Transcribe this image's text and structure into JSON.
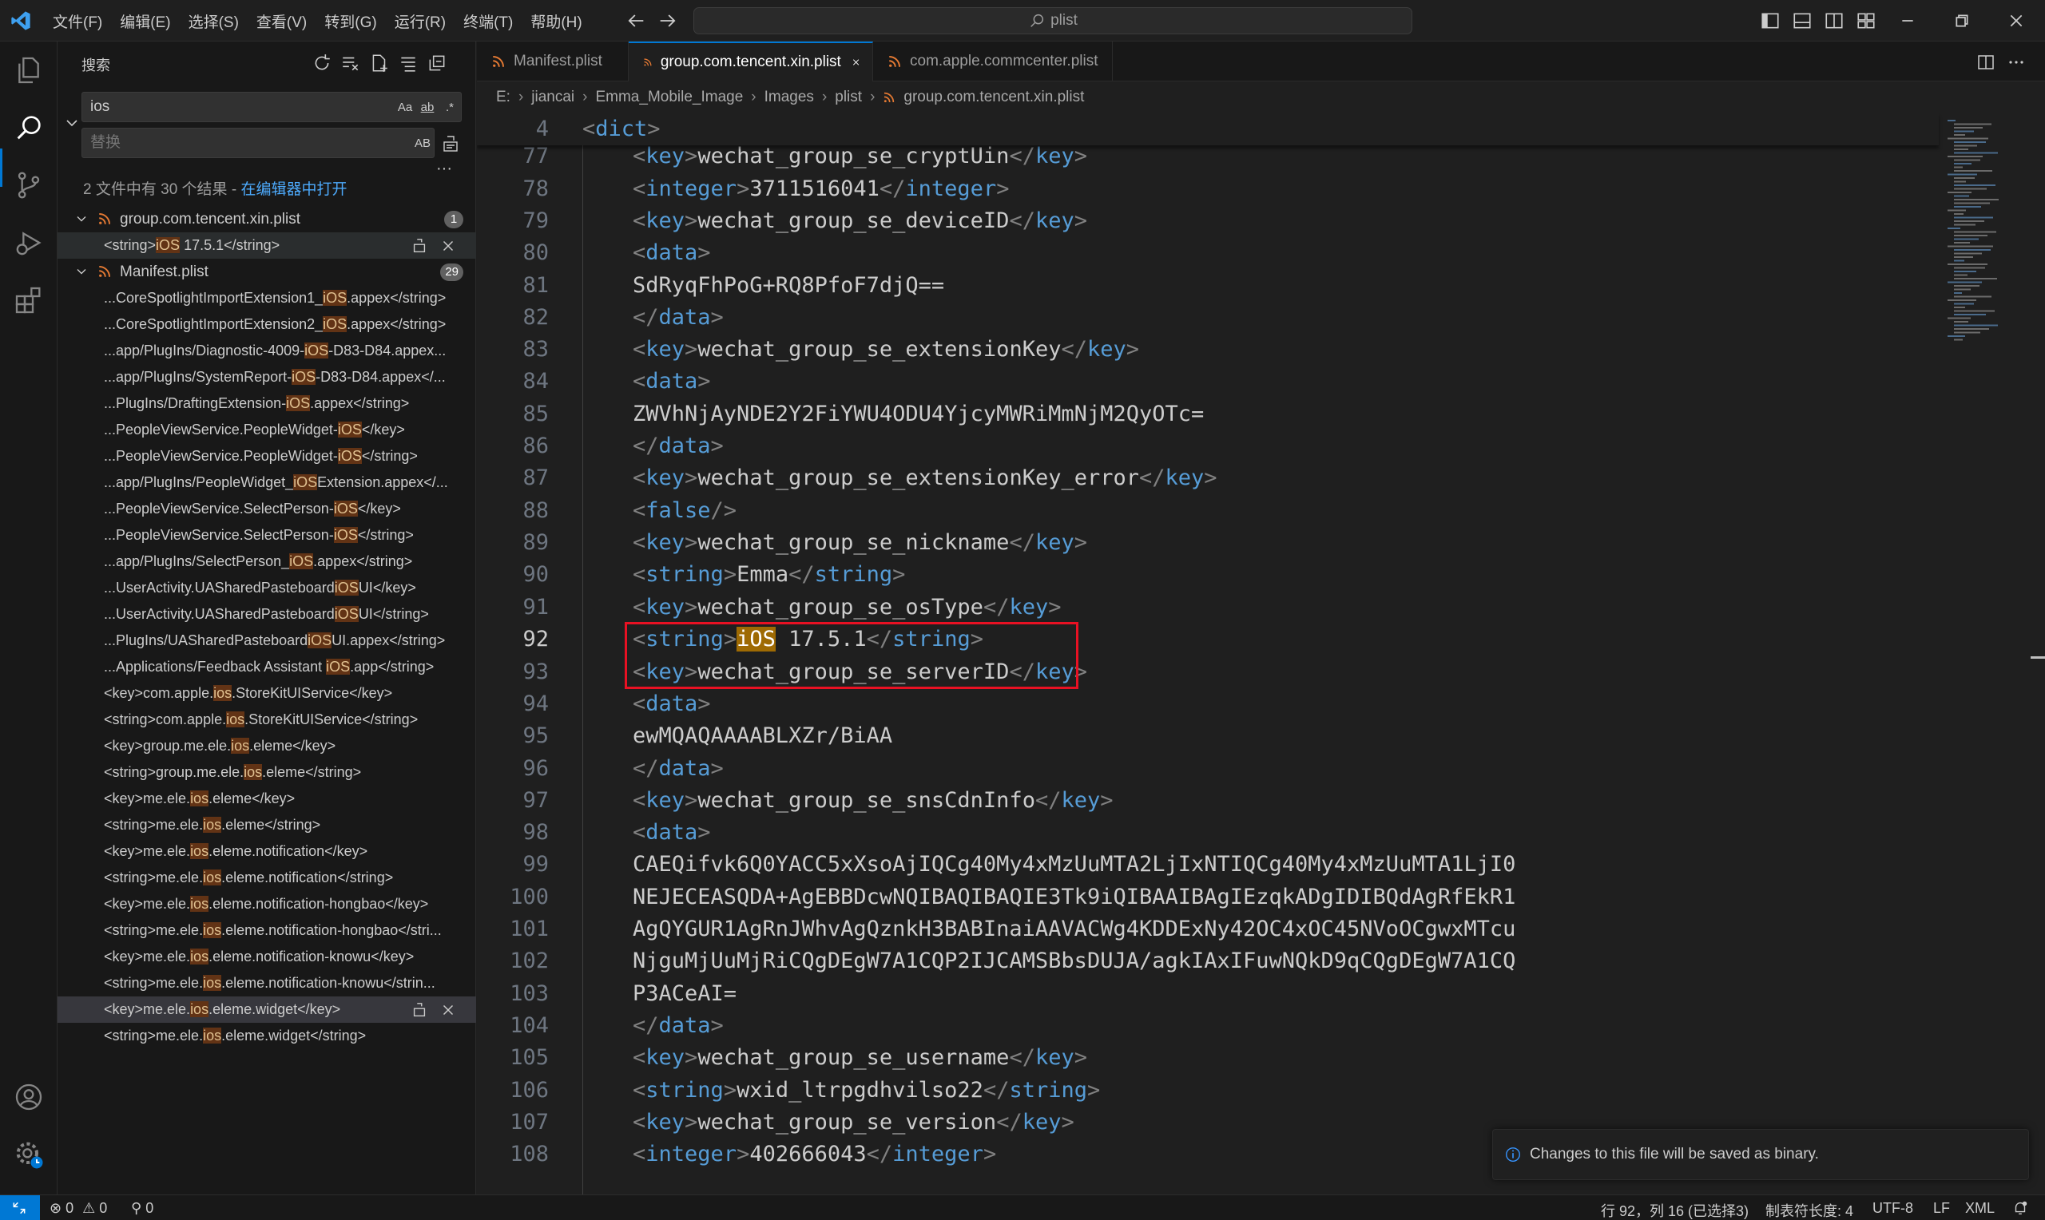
{
  "menu": [
    "文件(F)",
    "编辑(E)",
    "选择(S)",
    "查看(V)",
    "转到(G)",
    "运行(R)",
    "终端(T)",
    "帮助(H)"
  ],
  "command_center": {
    "text": "plist"
  },
  "sidebar": {
    "title": "搜索",
    "search_value": "ios",
    "search_options": [
      "Aa",
      "ab",
      ".*"
    ],
    "replace_placeholder": "替换",
    "replace_option": "AB",
    "summary": "2 文件中有 30 个结果 - ",
    "summary_link": "在编辑器中打开",
    "more": "···",
    "files": [
      {
        "name": "group.com.tencent.xin.plist",
        "count": "1",
        "matches": [
          {
            "pre": "<string>",
            "hit": "iOS",
            "post": " 17.5.1</string>",
            "state": "selected"
          }
        ]
      },
      {
        "name": "Manifest.plist",
        "count": "29",
        "matches": [
          {
            "pre": "...CoreSpotlightImportExtension1_",
            "hit": "iOS",
            "post": ".appex</string>"
          },
          {
            "pre": "...CoreSpotlightImportExtension2_",
            "hit": "iOS",
            "post": ".appex</string>"
          },
          {
            "pre": "...app/PlugIns/Diagnostic-4009-",
            "hit": "iOS",
            "post": "-D83-D84.appex..."
          },
          {
            "pre": "...app/PlugIns/SystemReport-",
            "hit": "iOS",
            "post": "-D83-D84.appex</..."
          },
          {
            "pre": "...PlugIns/DraftingExtension-",
            "hit": "iOS",
            "post": ".appex</string>"
          },
          {
            "pre": "...PeopleViewService.PeopleWidget-",
            "hit": "iOS",
            "post": "</key>"
          },
          {
            "pre": "...PeopleViewService.PeopleWidget-",
            "hit": "iOS",
            "post": "</string>"
          },
          {
            "pre": "...app/PlugIns/PeopleWidget_",
            "hit": "iOS",
            "post": "Extension.appex</..."
          },
          {
            "pre": "...PeopleViewService.SelectPerson-",
            "hit": "iOS",
            "post": "</key>"
          },
          {
            "pre": "...PeopleViewService.SelectPerson-",
            "hit": "iOS",
            "post": "</string>"
          },
          {
            "pre": "...app/PlugIns/SelectPerson_",
            "hit": "iOS",
            "post": ".appex</string>"
          },
          {
            "pre": "...UserActivity.UASharedPasteboard",
            "hit": "iOS",
            "post": "UI</key>"
          },
          {
            "pre": "...UserActivity.UASharedPasteboard",
            "hit": "iOS",
            "post": "UI</string>"
          },
          {
            "pre": "...PlugIns/UASharedPasteboard",
            "hit": "iOS",
            "post": "UI.appex</string>"
          },
          {
            "pre": "...Applications/Feedback Assistant ",
            "hit": "iOS",
            "post": ".app</string>"
          },
          {
            "pre": "<key>com.apple.",
            "hit": "ios",
            "post": ".StoreKitUIService</key>"
          },
          {
            "pre": "<string>com.apple.",
            "hit": "ios",
            "post": ".StoreKitUIService</string>"
          },
          {
            "pre": "<key>group.me.ele.",
            "hit": "ios",
            "post": ".eleme</key>"
          },
          {
            "pre": "<string>group.me.ele.",
            "hit": "ios",
            "post": ".eleme</string>"
          },
          {
            "pre": "<key>me.ele.",
            "hit": "ios",
            "post": ".eleme</key>"
          },
          {
            "pre": "<string>me.ele.",
            "hit": "ios",
            "post": ".eleme</string>"
          },
          {
            "pre": "<key>me.ele.",
            "hit": "ios",
            "post": ".eleme.notification</key>"
          },
          {
            "pre": "<string>me.ele.",
            "hit": "ios",
            "post": ".eleme.notification</string>"
          },
          {
            "pre": "<key>me.ele.",
            "hit": "ios",
            "post": ".eleme.notification-hongbao</key>"
          },
          {
            "pre": "<string>me.ele.",
            "hit": "ios",
            "post": ".eleme.notification-hongbao</stri..."
          },
          {
            "pre": "<key>me.ele.",
            "hit": "ios",
            "post": ".eleme.notification-knowu</key>"
          },
          {
            "pre": "<string>me.ele.",
            "hit": "ios",
            "post": ".eleme.notification-knowu</strin..."
          },
          {
            "pre": "<key>me.ele.",
            "hit": "ios",
            "post": ".eleme.widget</key>",
            "state": "active"
          },
          {
            "pre": "<string>me.ele.",
            "hit": "ios",
            "post": ".eleme.widget</string>"
          }
        ]
      }
    ]
  },
  "tabs": [
    {
      "label": "Manifest.plist",
      "active": false
    },
    {
      "label": "group.com.tencent.xin.plist",
      "active": true
    },
    {
      "label": "com.apple.commcenter.plist",
      "active": false
    }
  ],
  "breadcrumb": [
    "E:",
    "jiancai",
    "Emma_Mobile_Image",
    "Images",
    "plist",
    "group.com.tencent.xin.plist"
  ],
  "editor": {
    "sticky": {
      "ln": "4",
      "tag": "dict"
    },
    "current_line": "92",
    "highlight_word": "iOS",
    "lines": [
      {
        "ln": "76",
        "k": "close",
        "tag": "data"
      },
      {
        "ln": "77",
        "k": "el",
        "tag": "key",
        "text": "wechat_group_se_cryptUin"
      },
      {
        "ln": "78",
        "k": "el",
        "tag": "integer",
        "text": "3711516041"
      },
      {
        "ln": "79",
        "k": "el",
        "tag": "key",
        "text": "wechat_group_se_deviceID"
      },
      {
        "ln": "80",
        "k": "open",
        "tag": "data"
      },
      {
        "ln": "81",
        "k": "text",
        "text": "SdRyqFhPoG+RQ8PfoF7djQ=="
      },
      {
        "ln": "82",
        "k": "close",
        "tag": "data"
      },
      {
        "ln": "83",
        "k": "el",
        "tag": "key",
        "text": "wechat_group_se_extensionKey"
      },
      {
        "ln": "84",
        "k": "open",
        "tag": "data"
      },
      {
        "ln": "85",
        "k": "text",
        "text": "ZWVhNjAyNDE2Y2FiYWU4ODU4YjcyMWRiMmNjM2QyOTc="
      },
      {
        "ln": "86",
        "k": "close",
        "tag": "data"
      },
      {
        "ln": "87",
        "k": "el",
        "tag": "key",
        "text": "wechat_group_se_extensionKey_error"
      },
      {
        "ln": "88",
        "k": "self",
        "tag": "false"
      },
      {
        "ln": "89",
        "k": "el",
        "tag": "key",
        "text": "wechat_group_se_nickname"
      },
      {
        "ln": "90",
        "k": "el",
        "tag": "string",
        "text": "Emma"
      },
      {
        "ln": "91",
        "k": "el",
        "tag": "key",
        "text": "wechat_group_se_osType"
      },
      {
        "ln": "92",
        "k": "el",
        "tag": "string",
        "text": "iOS 17.5.1"
      },
      {
        "ln": "93",
        "k": "el",
        "tag": "key",
        "text": "wechat_group_se_serverID"
      },
      {
        "ln": "94",
        "k": "open",
        "tag": "data"
      },
      {
        "ln": "95",
        "k": "text",
        "text": "ewMQAQAAAABLXZr/BiAA"
      },
      {
        "ln": "96",
        "k": "close",
        "tag": "data"
      },
      {
        "ln": "97",
        "k": "el",
        "tag": "key",
        "text": "wechat_group_se_snsCdnInfo"
      },
      {
        "ln": "98",
        "k": "open",
        "tag": "data"
      },
      {
        "ln": "99",
        "k": "text",
        "text": "CAEQifvk6Q0YACC5xXsoAjIQCg40My4xMzUuMTA2LjIxNTIQCg40My4xMzUuMTA1LjI0"
      },
      {
        "ln": "100",
        "k": "text",
        "text": "NEJECEASQDA+AgEBBDcwNQIBAQIBAQIE3Tk9iQIBAAIBAgIEzqkADgIDIBQdAgRfEkR1"
      },
      {
        "ln": "101",
        "k": "text",
        "text": "AgQYGUR1AgRnJWhvAgQznkH3BABInaiAAVACWg4KDDExNy42OC4xOC45NVoOCgwxMTcu"
      },
      {
        "ln": "102",
        "k": "text",
        "text": "NjguMjUuMjRiCQgDEgW7A1CQP2IJCAMSBbsDUJA/agkIAxIFuwNQkD9qCQgDEgW7A1CQ"
      },
      {
        "ln": "103",
        "k": "text",
        "text": "P3ACeAI="
      },
      {
        "ln": "104",
        "k": "close",
        "tag": "data"
      },
      {
        "ln": "105",
        "k": "el",
        "tag": "key",
        "text": "wechat_group_se_username"
      },
      {
        "ln": "106",
        "k": "el",
        "tag": "string",
        "text": "wxid_ltrpgdhvilso22"
      },
      {
        "ln": "107",
        "k": "el",
        "tag": "key",
        "text": "wechat_group_se_version"
      },
      {
        "ln": "108",
        "k": "el",
        "tag": "integer",
        "text": "402666043"
      }
    ]
  },
  "notification": {
    "text": "Changes to this file will be saved as binary."
  },
  "statusbar": {
    "errors": "0",
    "warnings": "0",
    "ports": "0",
    "position": "行 92，列 16 (已选择3)",
    "tab_size": "制表符长度: 4",
    "encoding": "UTF-8",
    "eol": "LF",
    "language": "XML"
  },
  "colors": {
    "accent": "#0078d4",
    "tag": "#569cd6",
    "match_bg": "#623315",
    "annotation": "#e81123"
  }
}
